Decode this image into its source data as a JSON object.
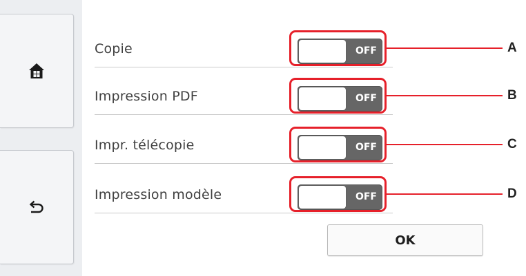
{
  "sidebar": {
    "home_icon": "home-icon",
    "back_icon": "back-arrow-icon"
  },
  "settings": [
    {
      "label": "Copie",
      "state": "OFF",
      "callout": "A"
    },
    {
      "label": "Impression PDF",
      "state": "OFF",
      "callout": "B"
    },
    {
      "label": "Impr. télécopie",
      "state": "OFF",
      "callout": "C"
    },
    {
      "label": "Impression modèle",
      "state": "OFF",
      "callout": "D"
    }
  ],
  "ok_label": "OK",
  "colors": {
    "highlight": "#e6202a",
    "toggle_off": "#666666"
  }
}
